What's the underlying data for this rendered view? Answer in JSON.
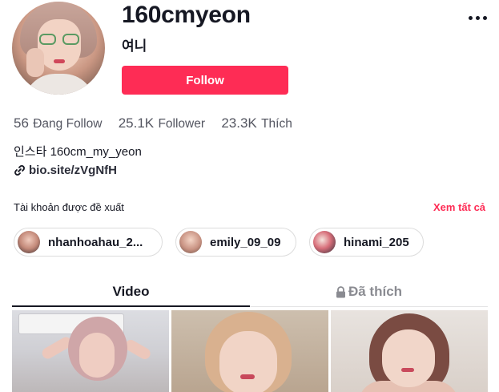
{
  "profile": {
    "username": "160cmyeon",
    "nickname": "여니",
    "follow_label": "Follow"
  },
  "stats": [
    {
      "value": "56",
      "label": "Đang Follow"
    },
    {
      "value": "25.1K",
      "label": "Follower"
    },
    {
      "value": "23.3K",
      "label": "Thích"
    }
  ],
  "bio": {
    "text": "인스타 160cm_my_yeon",
    "link": "bio.site/zVgNfH"
  },
  "suggested": {
    "title": "Tài khoản được đề xuất",
    "see_all": "Xem tất cả",
    "accounts": [
      {
        "name": "nhanhoahau_2..."
      },
      {
        "name": "emily_09_09"
      },
      {
        "name": "hinami_205"
      }
    ]
  },
  "tabs": {
    "video": "Video",
    "liked": "Đã thích"
  },
  "colors": {
    "accent": "#fe2c55",
    "text": "#161823",
    "muted": "#545661"
  },
  "icons": {
    "more": "more-dots-icon",
    "link": "link-icon",
    "lock": "lock-icon"
  }
}
